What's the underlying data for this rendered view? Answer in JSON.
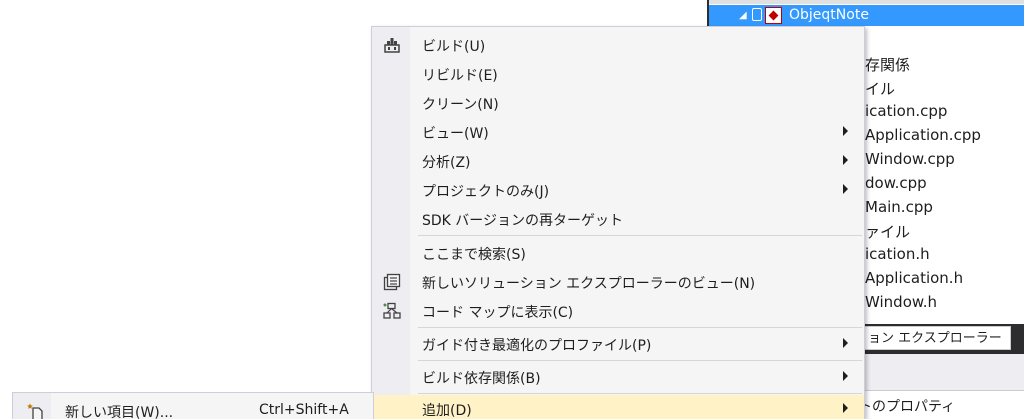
{
  "solution_explorer": {
    "selected_project": "ObjeqtNote",
    "rows": [
      "存関係",
      "イル",
      "ication.cpp",
      "Application.cpp",
      "Window.cpp",
      "dow.cpp",
      "Main.cpp",
      "ァイル",
      "ication.h",
      "Application.h",
      "Window.h"
    ],
    "tab_label": "ョン エクスプローラー",
    "properties_label": "トのプロパティ"
  },
  "context_menu": {
    "items": [
      {
        "label": "ビルド(U)",
        "icon": "build-icon"
      },
      {
        "label": "リビルド(E)"
      },
      {
        "label": "クリーン(N)"
      },
      {
        "label": "ビュー(W)",
        "submenu": true
      },
      {
        "label": "分析(Z)",
        "submenu": true
      },
      {
        "label": "プロジェクトのみ(J)",
        "submenu": true
      },
      {
        "label": "SDK バージョンの再ターゲット"
      },
      {
        "label": "ここまで検索(S)"
      },
      {
        "label": "新しいソリューション エクスプローラーのビュー(N)",
        "icon": "new-view-icon"
      },
      {
        "label": "コード マップに表示(C)",
        "icon": "code-map-icon"
      },
      {
        "label": "ガイド付き最適化のプロファイル(P)",
        "submenu": true
      },
      {
        "label": "ビルド依存関係(B)",
        "submenu": true
      },
      {
        "label": "追加(D)",
        "submenu": true,
        "highlighted": true
      }
    ]
  },
  "submenu": {
    "items": [
      {
        "label": "新しい項目(W)...",
        "shortcut": "Ctrl+Shift+A",
        "icon": "new-item-icon"
      }
    ]
  },
  "colors": {
    "selection": "#3399ff",
    "highlight": "#fff2c6",
    "menu_bg": "#f5f5f5"
  }
}
